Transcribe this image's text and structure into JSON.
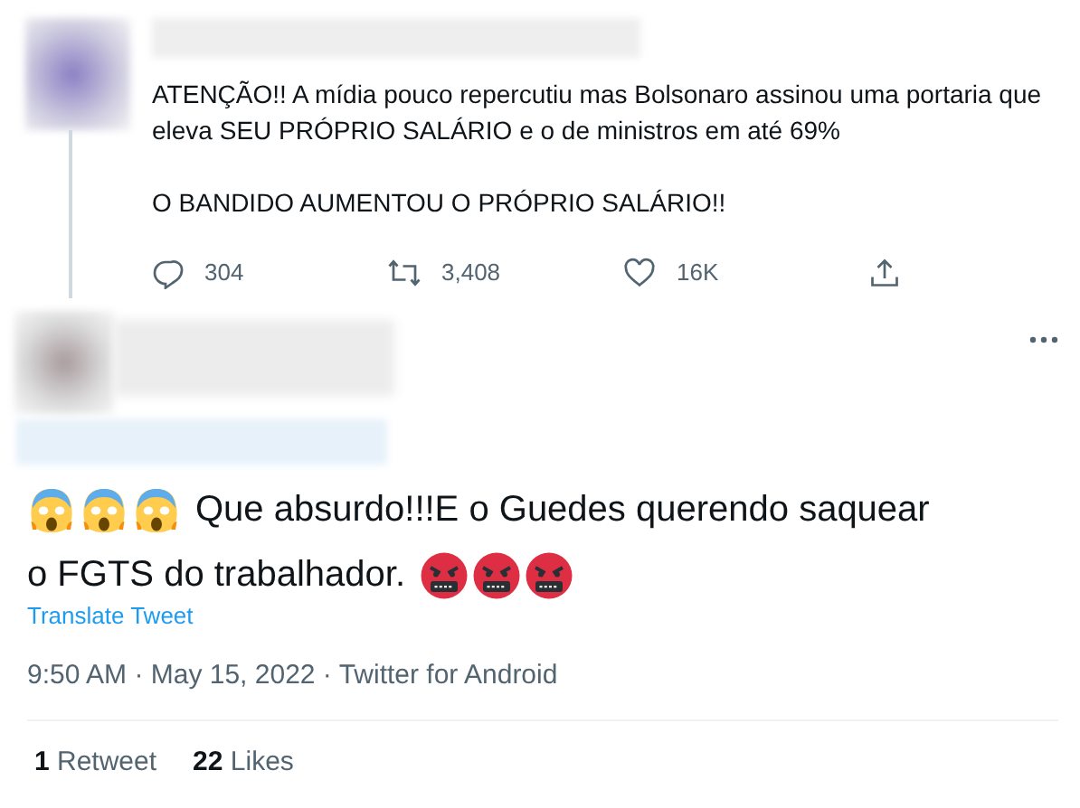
{
  "quoted_tweet": {
    "paragraphs": [
      "ATENÇÃO!! A mídia pouco repercutiu mas Bolsonaro assinou uma portaria que eleva SEU PRÓPRIO SALÁRIO e o de ministros em até 69%",
      "O BANDIDO AUMENTOU O PRÓPRIO SALÁRIO!!"
    ],
    "actions": [
      {
        "kind": "reply",
        "count": "304"
      },
      {
        "kind": "retweet",
        "count": "3,408"
      },
      {
        "kind": "like",
        "count": "16K"
      },
      {
        "kind": "share"
      }
    ]
  },
  "tweet": {
    "text_lines": [
      "Que absurdo!!!E o Guedes querendo saquear",
      "o FGTS do trabalhador."
    ],
    "translate": "Translate Tweet",
    "meta": "9:50 AM · May 15, 2022 · Twitter for Android",
    "stats": [
      {
        "text": "**1** Retweet"
      },
      {
        "text": "**22** Likes"
      }
    ]
  }
}
